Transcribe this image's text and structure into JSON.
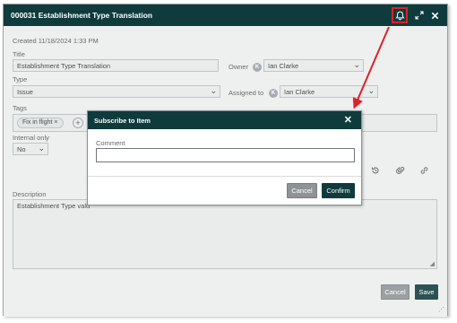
{
  "window": {
    "title": "000031 Establishment Type Translation",
    "created": "Created 11/18/2024 1:33 PM"
  },
  "form": {
    "title_label": "Title",
    "title_value": "Establishment Type Translation",
    "owner_label": "Owner",
    "owner_initial": "K",
    "owner_value": "Ian Clarke",
    "type_label": "Type",
    "type_value": "Issue",
    "assigned_label": "Assigned to",
    "assigned_initial": "K",
    "assigned_value": "Ian Clarke",
    "tags_label": "Tags",
    "tag_chip": "Fix in flight",
    "tag_chip_remove": "×",
    "tag_add": "+",
    "internal_label": "Internal only",
    "internal_value": "No",
    "description_label": "Description",
    "description_value": "Establishment Type valu"
  },
  "footer": {
    "cancel_label": "Cancel",
    "save_label": "Save"
  },
  "dialog": {
    "title": "Subscribe to Item",
    "close_glyph": "✕",
    "comment_label": "Comment",
    "comment_value": "",
    "cancel_label": "Cancel",
    "confirm_label": "Confirm"
  },
  "icons": {
    "bell": "bell-icon",
    "expand": "expand-icon",
    "close": "close-icon",
    "history": "history-icon",
    "attach": "paperclip-icon",
    "link": "link-icon",
    "resize": "resize-handle-icon"
  },
  "colors": {
    "header": "#0f3b3c",
    "highlight": "#e01f26",
    "button_grey": "#8e9496"
  }
}
